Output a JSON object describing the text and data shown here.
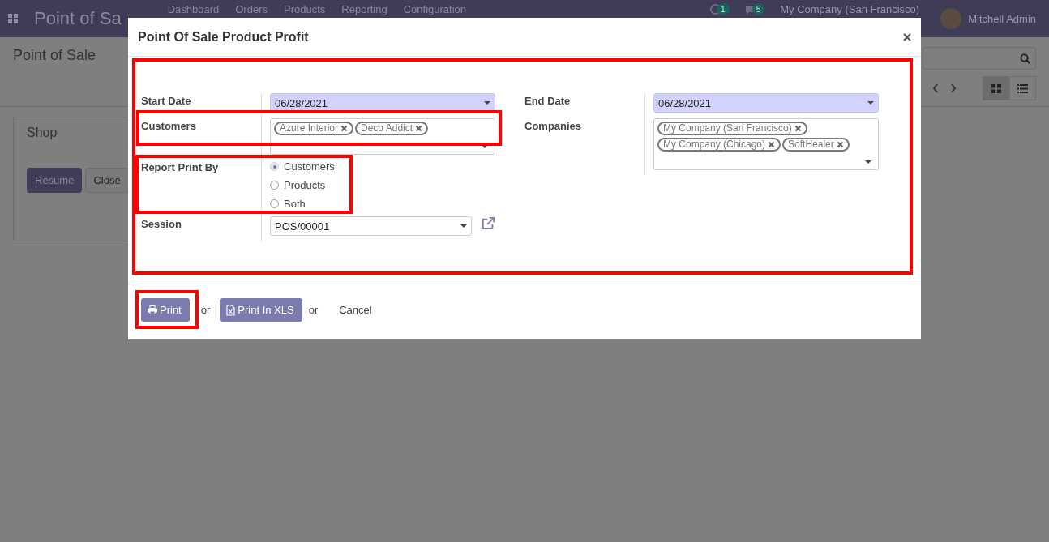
{
  "navbar": {
    "app_title": "Point of Sa",
    "menu": [
      "Dashboard",
      "Orders",
      "Products",
      "Reporting",
      "Configuration"
    ],
    "activity_count": "1",
    "message_count": "5",
    "company": "My Company (San Francisco)",
    "user": "Mitchell Admin"
  },
  "control_panel": {
    "breadcrumb": "Point of Sale",
    "views": [
      {
        "kind": "kanban",
        "selected": true
      },
      {
        "kind": "list",
        "selected": false
      }
    ]
  },
  "kanban": {
    "card_title": "Shop",
    "buttons": [
      {
        "label": "Resume",
        "kind": "primary"
      },
      {
        "label": "Close",
        "kind": "secondary"
      }
    ]
  },
  "dialog": {
    "title": "Point Of Sale Product Profit",
    "left_fields": [
      {
        "kind": "date",
        "label": "Start Date",
        "value": "06/28/2021"
      },
      {
        "kind": "tags",
        "label": "Customers",
        "tags": [
          "Azure Interior",
          "Deco Addict"
        ]
      },
      {
        "kind": "radio",
        "label": "Report Print By",
        "options": [
          {
            "label": "Customers",
            "selected": true
          },
          {
            "label": "Products",
            "selected": false
          },
          {
            "label": "Both",
            "selected": false
          }
        ]
      },
      {
        "kind": "select",
        "label": "Session",
        "value": "POS/00001"
      }
    ],
    "right_fields": [
      {
        "kind": "date",
        "label": "End Date",
        "value": "06/28/2021"
      },
      {
        "kind": "tags",
        "label": "Companies",
        "tags": [
          "My Company (San Francisco)",
          "My Company (Chicago)",
          "SoftHealer"
        ]
      }
    ],
    "footer": [
      {
        "kind": "print",
        "label": "Print"
      },
      {
        "kind": "text",
        "label": "or"
      },
      {
        "kind": "export",
        "label": "Print In XLS"
      },
      {
        "kind": "text",
        "label": "or"
      },
      {
        "kind": "link",
        "label": "Cancel"
      }
    ]
  }
}
